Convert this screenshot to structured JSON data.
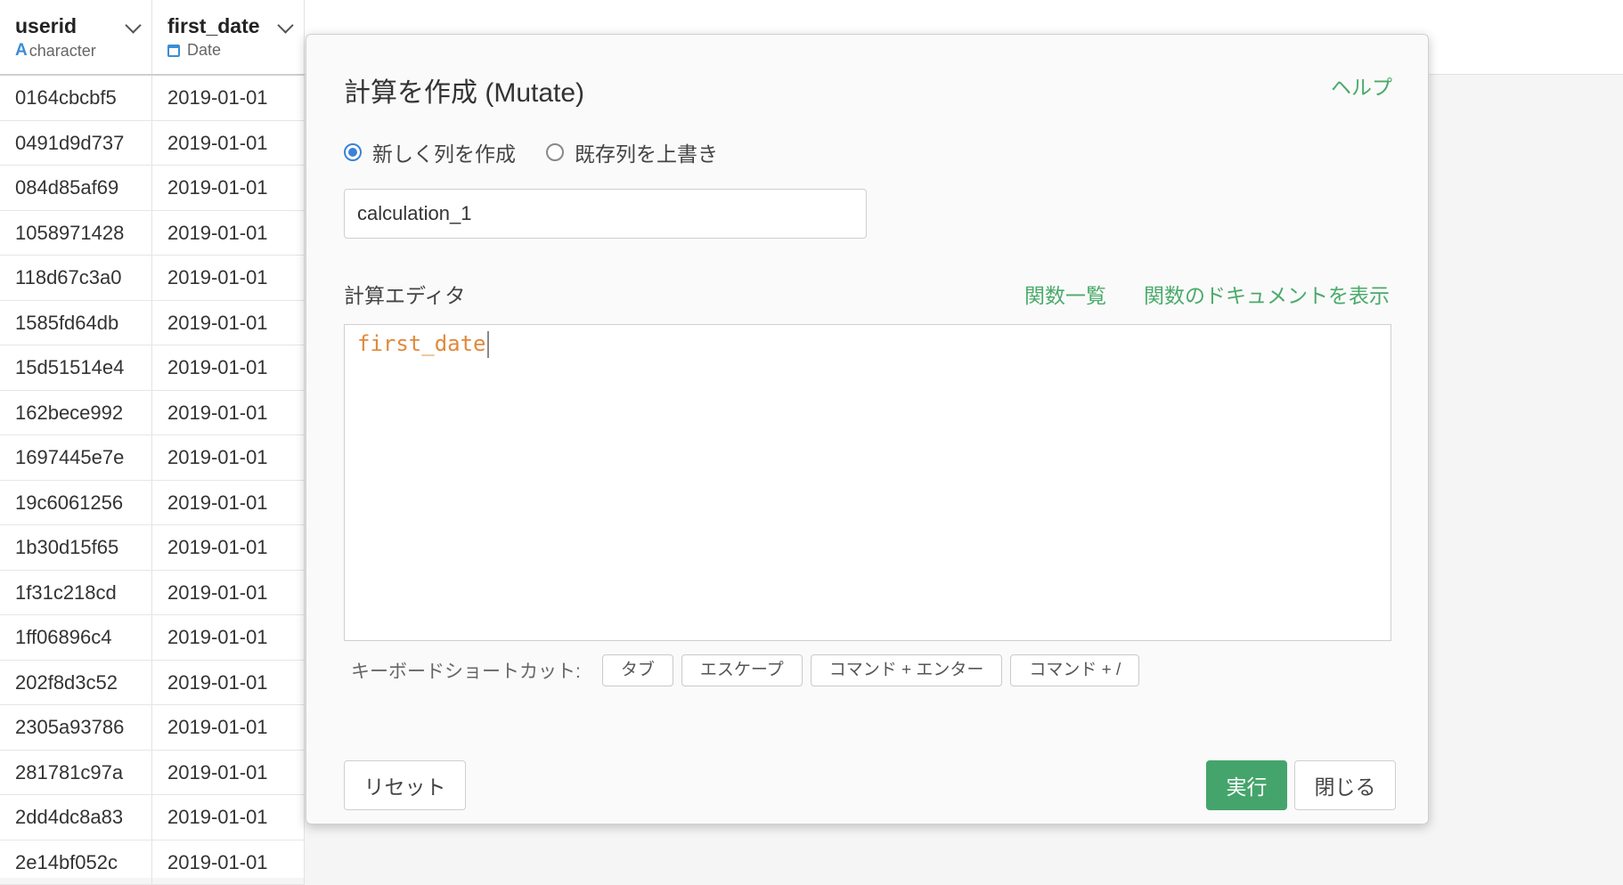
{
  "table": {
    "columns": [
      {
        "name": "userid",
        "type": "character",
        "type_icon": "character-type-icon"
      },
      {
        "name": "first_date",
        "type": "Date",
        "type_icon": "calendar-icon"
      }
    ],
    "rows": [
      {
        "userid": "0164cbcbf5",
        "first_date": "2019-01-01"
      },
      {
        "userid": "0491d9d737",
        "first_date": "2019-01-01"
      },
      {
        "userid": "084d85af69",
        "first_date": "2019-01-01"
      },
      {
        "userid": "1058971428",
        "first_date": "2019-01-01"
      },
      {
        "userid": "118d67c3a0",
        "first_date": "2019-01-01"
      },
      {
        "userid": "1585fd64db",
        "first_date": "2019-01-01"
      },
      {
        "userid": "15d51514e4",
        "first_date": "2019-01-01"
      },
      {
        "userid": "162bece992",
        "first_date": "2019-01-01"
      },
      {
        "userid": "1697445e7e",
        "first_date": "2019-01-01"
      },
      {
        "userid": "19c6061256",
        "first_date": "2019-01-01"
      },
      {
        "userid": "1b30d15f65",
        "first_date": "2019-01-01"
      },
      {
        "userid": "1f31c218cd",
        "first_date": "2019-01-01"
      },
      {
        "userid": "1ff06896c4",
        "first_date": "2019-01-01"
      },
      {
        "userid": "202f8d3c52",
        "first_date": "2019-01-01"
      },
      {
        "userid": "2305a93786",
        "first_date": "2019-01-01"
      },
      {
        "userid": "281781c97a",
        "first_date": "2019-01-01"
      },
      {
        "userid": "2dd4dc8a83",
        "first_date": "2019-01-01"
      },
      {
        "userid": "2e14bf052c",
        "first_date": "2019-01-01"
      }
    ]
  },
  "modal": {
    "title": "計算を作成 (Mutate)",
    "help_label": "ヘルプ",
    "radio_new_label": "新しく列を作成",
    "radio_overwrite_label": "既存列を上書き",
    "selected_radio": "new",
    "column_name_value": "calculation_1",
    "editor_label": "計算エディタ",
    "function_list_label": "関数一覧",
    "function_docs_label": "関数のドキュメントを表示",
    "editor_content": "first_date",
    "shortcuts_label": "キーボードショートカット:",
    "shortcuts": [
      "タブ",
      "エスケープ",
      "コマンド + エンター",
      "コマンド + /"
    ],
    "reset_label": "リセット",
    "run_label": "実行",
    "close_label": "閉じる"
  },
  "colors": {
    "accent_green": "#45a46b",
    "link_green": "#4aaa6a",
    "radio_blue": "#3b82d4",
    "editor_text": "#e08a3c"
  }
}
